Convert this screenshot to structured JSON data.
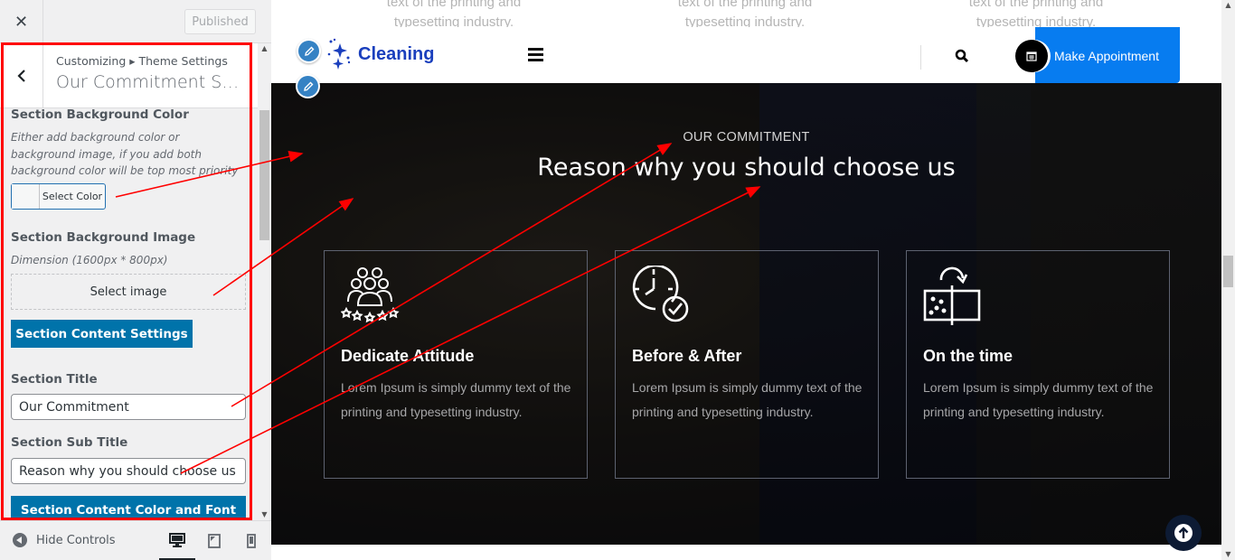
{
  "header": {
    "close_label": "✕",
    "published_label": "Published"
  },
  "panel": {
    "back_label": "‹",
    "breadcrumb": "Customizing ▸ Theme Settings",
    "title": "Our Commitment Sec…"
  },
  "controls": {
    "bg_color_label": "Section Background Color",
    "bg_color_desc": "Either add background color or background image, if you add both background color will be top most priority",
    "select_color_label": "Select Color",
    "bg_image_label": "Section Background Image",
    "bg_image_desc": "Dimension (1600px * 800px)",
    "select_image_label": "Select image",
    "content_settings_label": "Section Content Settings",
    "section_title_label": "Section Title",
    "section_title_value": "Our Commitment",
    "section_subtitle_label": "Section Sub Title",
    "section_subtitle_value": "Reason why you should choose us",
    "content_color_font_label": "Section Content Color and Font"
  },
  "footer": {
    "hide_controls_label": "Hide Controls",
    "devices": [
      "desktop",
      "tablet",
      "mobile"
    ],
    "active_device": "desktop"
  },
  "preview": {
    "top_fade_line1": "text of the printing and",
    "top_fade_line2": "typesetting industry.",
    "logo_text": "Cleaning",
    "appointment_label": "Make Appointment",
    "section_subtitle": "OUR COMMITMENT",
    "section_title": "Reason why you should choose us",
    "cards": [
      {
        "icon": "team-rating-icon",
        "title": "Dedicate Attitude",
        "text": "Lorem Ipsum is simply dummy text of the printing and typesetting industry."
      },
      {
        "icon": "clock-check-icon",
        "title": "Before & After",
        "text": "Lorem Ipsum is simply dummy text of the printing and typesetting industry."
      },
      {
        "icon": "before-after-icon",
        "title": "On the time",
        "text": "Lorem Ipsum is simply dummy text of the printing and typesetting industry."
      }
    ]
  },
  "colors": {
    "accent_blue": "#0073aa",
    "brand_blue": "#1a3fbd",
    "appointment_blue": "#077cf0",
    "annotation_red": "#ff0000"
  }
}
